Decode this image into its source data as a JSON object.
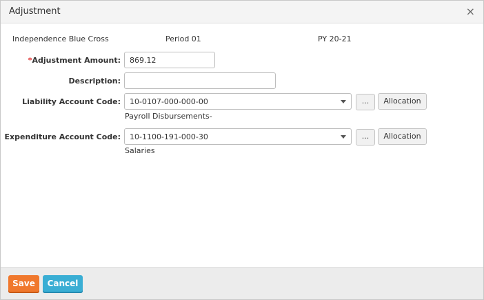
{
  "dialog": {
    "title": "Adjustment",
    "close_glyph": "×"
  },
  "info": {
    "vendor": "Independence Blue Cross",
    "period": "Period 01",
    "plan_year": "PY 20-21"
  },
  "form": {
    "adjustment_amount": {
      "required_mark": "*",
      "label": "Adjustment Amount:",
      "value": "869.12"
    },
    "description": {
      "label": "Description:",
      "value": ""
    },
    "liability_account": {
      "label": "Liability Account Code:",
      "value": "10-0107-000-000-00",
      "description": "Payroll Disbursements-",
      "lookup_label": "...",
      "allocation_label": "Allocation"
    },
    "expenditure_account": {
      "label": "Expenditure Account Code:",
      "value": "10-1100-191-000-30",
      "description": "Salaries",
      "lookup_label": "...",
      "allocation_label": "Allocation"
    }
  },
  "footer": {
    "save_label": "Save",
    "cancel_label": "Cancel"
  },
  "colors": {
    "save": "#f0782d",
    "cancel": "#3aaed4",
    "required": "#e03030"
  },
  "icons": {
    "close": "close-icon",
    "dropdown": "chevron-down-icon"
  }
}
